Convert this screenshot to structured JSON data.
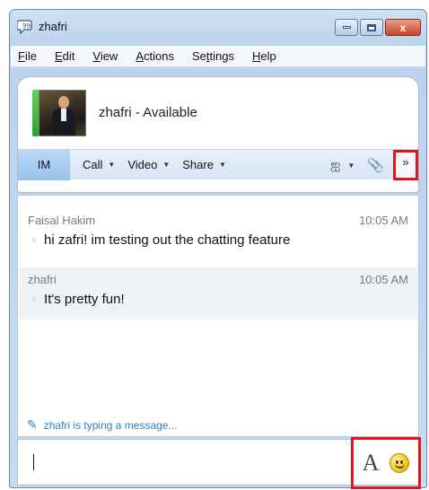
{
  "window": {
    "title": "zhafri",
    "close_glyph": "x"
  },
  "menubar": {
    "items": [
      {
        "underline": "F",
        "rest": "ile"
      },
      {
        "underline": "E",
        "rest": "dit"
      },
      {
        "underline": "V",
        "rest": "iew"
      },
      {
        "underline": "A",
        "rest": "ctions"
      },
      {
        "pre": "Se",
        "underline": "t",
        "rest": "tings"
      },
      {
        "underline": "H",
        "rest": "elp"
      }
    ]
  },
  "contact": {
    "status_text": "zhafri - Available",
    "presence_color": "#3bbf36"
  },
  "toolbar": {
    "im_label": "IM",
    "call_label": "Call",
    "video_label": "Video",
    "share_label": "Share",
    "overflow_glyph": "»"
  },
  "messages": [
    {
      "sender": "Faisal Hakim",
      "time": "10:05 AM",
      "text": "hi zafri! im testing out the chatting feature"
    },
    {
      "sender": "zhafri",
      "time": "10:05 AM",
      "text": "It's pretty fun!"
    }
  ],
  "typing_indicator": "zhafri is typing a message...",
  "input": {
    "font_button_glyph": "A"
  },
  "colors": {
    "highlight_box": "#e0161b",
    "im_tab": "#a8cdf2",
    "link_blue": "#2f7fb8"
  }
}
